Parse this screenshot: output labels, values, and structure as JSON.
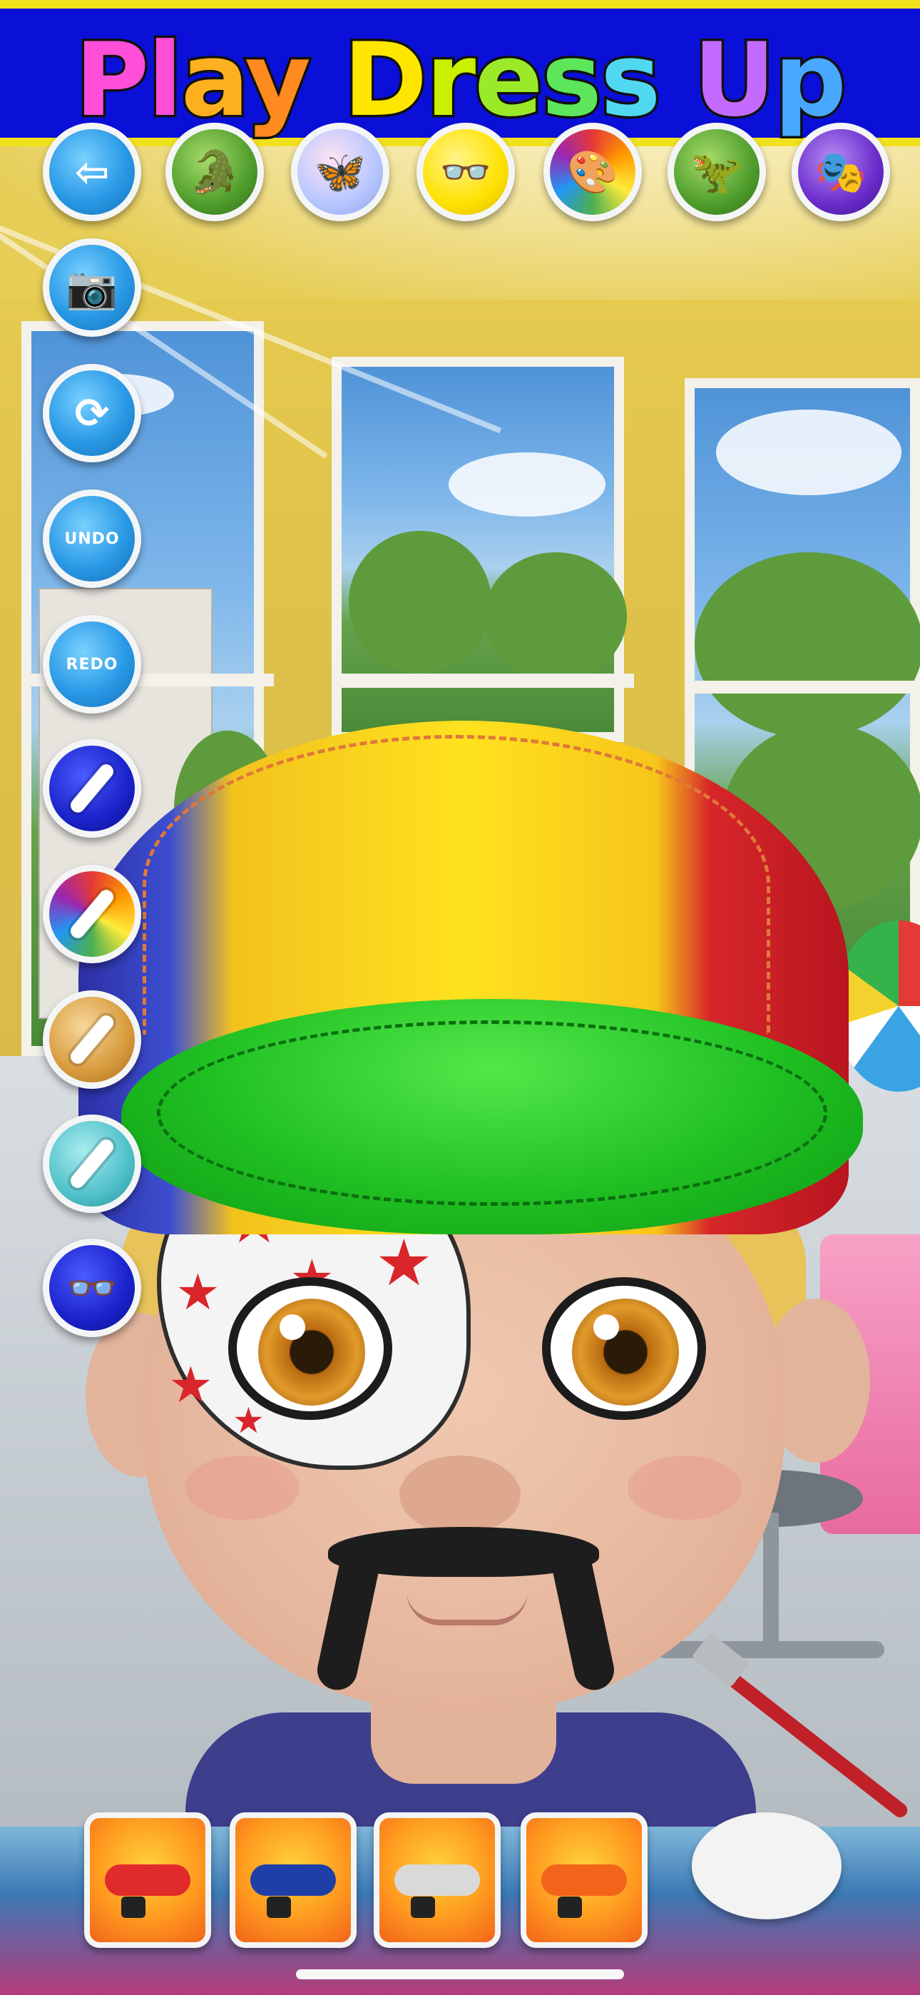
{
  "app": {
    "title_letters": [
      "P",
      "l",
      "a",
      "y",
      " ",
      "D",
      "r",
      "e",
      "s",
      "s",
      " ",
      "U",
      "p"
    ],
    "title_colors": [
      "#ff4fd8",
      "#ff4fd8",
      "#ffb020",
      "#ff8a1f",
      "",
      "#ffe600",
      "#c8f000",
      "#9bea2a",
      "#5de55b",
      "#4fd8f0",
      "",
      "#c36bff",
      "#48a8ff"
    ]
  },
  "top_buttons": [
    {
      "name": "back-button",
      "icon": "arrow-left-icon",
      "glyph": "⇦",
      "style": "c-blue"
    },
    {
      "name": "category-crocodile-button",
      "icon": "crocodile-icon",
      "glyph": "🐊",
      "style": "c-green"
    },
    {
      "name": "category-butterfly-button",
      "icon": "butterfly-icon",
      "glyph": "🦋",
      "style": "c-pastel"
    },
    {
      "name": "category-glasses-button",
      "icon": "glasses-icon",
      "glyph": "👓",
      "style": "c-yellow"
    },
    {
      "name": "category-palette-button",
      "icon": "paint-palette-icon",
      "glyph": "🎨",
      "style": "c-palette"
    },
    {
      "name": "category-dinosaur-button",
      "icon": "dinosaur-icon",
      "glyph": "🦖",
      "style": "c-green"
    },
    {
      "name": "category-mask-button",
      "icon": "mask-icon",
      "glyph": "🎭",
      "style": "c-purple"
    }
  ],
  "side_buttons": [
    {
      "name": "camera-button",
      "icon": "camera-icon",
      "glyph": "📷",
      "label": "",
      "style": "c-blue"
    },
    {
      "name": "reset-button",
      "icon": "refresh-icon",
      "glyph": "⟳",
      "label": "",
      "style": "c-blue"
    },
    {
      "name": "undo-button",
      "icon": "undo-arrow-icon",
      "glyph": "",
      "label": "UNDO",
      "style": "c-blue"
    },
    {
      "name": "redo-button",
      "icon": "redo-arrow-icon",
      "glyph": "",
      "label": "REDO",
      "style": "c-blue"
    },
    {
      "name": "brush-blue-button",
      "icon": "paintbrush-icon",
      "glyph": "",
      "label": "",
      "style": "c-deep"
    },
    {
      "name": "brush-rainbow-button",
      "icon": "paintbrush-icon",
      "glyph": "",
      "label": "",
      "style": "c-rainbow"
    },
    {
      "name": "brush-gold-glitter-button",
      "icon": "paintbrush-icon",
      "glyph": "",
      "label": "",
      "style": "c-gold"
    },
    {
      "name": "brush-teal-glitter-button",
      "icon": "paintbrush-icon",
      "glyph": "",
      "label": "",
      "style": "c-teal"
    },
    {
      "name": "glasses-button",
      "icon": "glasses-icon",
      "glyph": "👓",
      "label": "",
      "style": "c-deep"
    }
  ],
  "bottom_tiles": [
    {
      "name": "face-paint-option-1",
      "icon": "face-paint-mask-icon",
      "mask_color": "#e12b2b"
    },
    {
      "name": "face-paint-option-2",
      "icon": "face-paint-mask-icon",
      "mask_color": "#1f3fa8"
    },
    {
      "name": "face-paint-option-3",
      "icon": "face-paint-mask-icon",
      "mask_color": "#d9d9d9"
    },
    {
      "name": "face-paint-option-4",
      "icon": "face-paint-mask-icon",
      "mask_color": "#f2641a"
    }
  ]
}
